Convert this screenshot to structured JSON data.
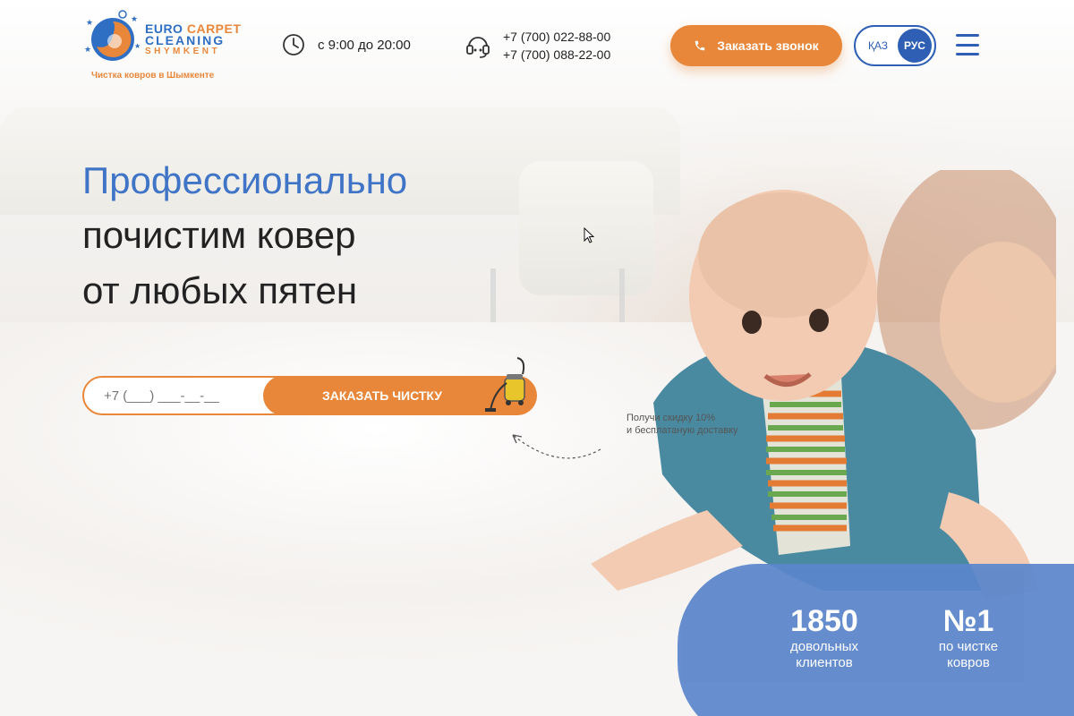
{
  "logo": {
    "line1a": "EURO",
    "line1b": "CARPET",
    "line2": "CLEANING",
    "line3": "SHYMKENT",
    "tagline": "Чистка ковров в Шымкенте"
  },
  "header": {
    "hours": "с 9:00 до 20:00",
    "phones": [
      "+7 (700) 022-88-00",
      "+7 (700) 088-22-00"
    ],
    "call_button": "Заказать звонок",
    "lang_kaz": "ҚАЗ",
    "lang_rus": "РУС"
  },
  "hero": {
    "line1": "Профессионально",
    "line2": "почистим ковер",
    "line3": "от любых пятен"
  },
  "order": {
    "phone_placeholder": "+7 (___) ___-__-__",
    "button": "ЗАКАЗАТЬ ЧИСТКУ",
    "promo_line1": "Получи скидку 10%",
    "promo_line2": "и бесплатаную доставку"
  },
  "stats": [
    {
      "value": "1850",
      "label1": "довольных",
      "label2": "клиентов"
    },
    {
      "value": "№1",
      "label1": "по чистке",
      "label2": "ковров"
    }
  ],
  "colors": {
    "accent": "#e8873a",
    "brand_blue": "#2f5fb5",
    "headline_blue": "#3f74c6",
    "stats_bg": "#5b86cc"
  }
}
